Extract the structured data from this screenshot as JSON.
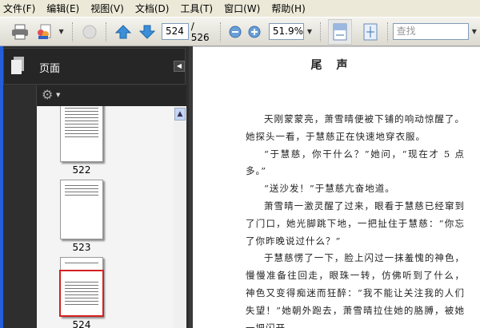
{
  "menu": [
    "文件(F)",
    "编辑(E)",
    "视图(V)",
    "文档(D)",
    "工具(T)",
    "窗口(W)",
    "帮助(H)"
  ],
  "toolbar": {
    "current_page": "524",
    "total_pages": "/ 526",
    "zoom": "51.9%",
    "find_placeholder": "查找"
  },
  "panel": {
    "title": "页面",
    "thumbnails": [
      {
        "label": "522"
      },
      {
        "label": "523"
      },
      {
        "label": "524",
        "selected": true
      }
    ]
  },
  "document": {
    "title": "尾声",
    "paragraphs": [
      "天刚蒙蒙亮，萧雪晴便被下铺的响动惊醒了。她探头一看，于慧慈正在快速地穿衣服。",
      "“于慧慈，你干什么？”她问，“现在才 5 点多。”",
      "“送沙发！”于慧慈亢奋地道。",
      "萧雪晴一激灵醒了过来，眼看于慧慈已经窜到了门口，她光脚跳下地，一把扯住于慧慈：“你忘了你昨晚说过什么？”",
      "于慧慈愣了一下，脸上闪过一抹羞愧的神色，慢慢准备往回走，眼珠一转，仿佛听到了什么，神色又变得痴迷而狂醉：“我不能让关注我的人们失望！”她朝外跑去，萧雪晴拉住她的胳膊，被她一把闪开。"
    ]
  },
  "colors": {
    "selection": "#d42020",
    "panel": "#2e2e2e",
    "taskbar_blue": "#245edb"
  }
}
